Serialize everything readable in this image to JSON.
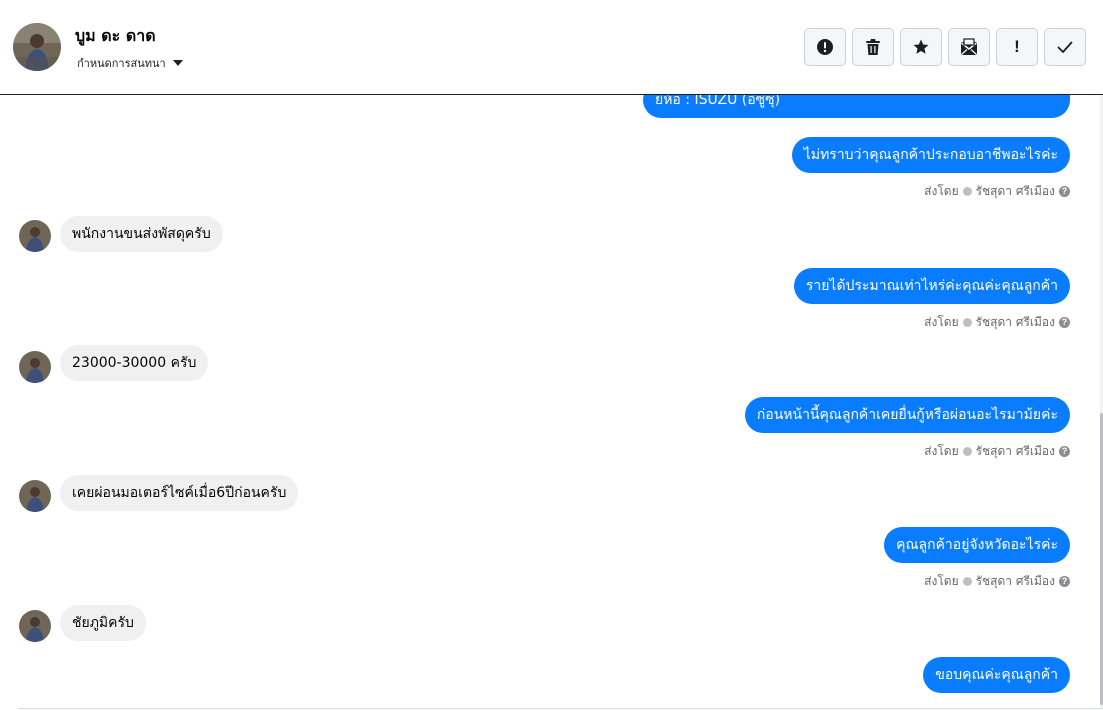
{
  "contact": {
    "name": "บูม ดะ ดาด",
    "menu_label": "กำหนดการสนทนา"
  },
  "toolbar": {
    "buttons": [
      {
        "icon": "alert-circle-icon",
        "label": "!"
      },
      {
        "icon": "trash-icon"
      },
      {
        "icon": "star-icon"
      },
      {
        "icon": "mail-icon"
      },
      {
        "icon": "exclamation-icon",
        "label": "!"
      },
      {
        "icon": "checkmark-icon"
      }
    ]
  },
  "sender_meta": {
    "prefix": "ส่งโดย",
    "sender": "รัชสุดา ศรีเมือง",
    "help": "?"
  },
  "messages": [
    {
      "direction": "out",
      "text": "ยี่ห้อ : ISUZU (อีซูซุ)"
    },
    {
      "direction": "out",
      "text": "ไม่ทราบว่าคุณลูกค้าประกอบอาชีพอะไรค่ะ"
    },
    {
      "direction": "in",
      "text": "พนักงานขนส่งพัสดุครับ"
    },
    {
      "direction": "out",
      "text": "รายได้ประมาณเท่าไหร่ค่ะคุณค่ะคุณลูกค้า"
    },
    {
      "direction": "in",
      "text": "23000-30000 ครับ"
    },
    {
      "direction": "out",
      "text": "ก่อนหน้านี้คุณลูกค้าเคยยื่นกู้หรือผ่อนอะไรมาม้ยค่ะ"
    },
    {
      "direction": "in",
      "text": "เคยผ่อนมอเตอร์ไซค์เมื่อ6ปีก่อนครับ"
    },
    {
      "direction": "out",
      "text": "คุณลูกค้าอยู่จังหวัดอะไรค่ะ"
    },
    {
      "direction": "in",
      "text": "ชัยภูมิครับ"
    },
    {
      "direction": "out",
      "text": "ขอบคุณค่ะคุณลูกค้า"
    }
  ],
  "colors": {
    "outgoing_bubble": "#0a7cff",
    "incoming_bubble": "#f0f0f0",
    "meta_text": "#65676b"
  }
}
